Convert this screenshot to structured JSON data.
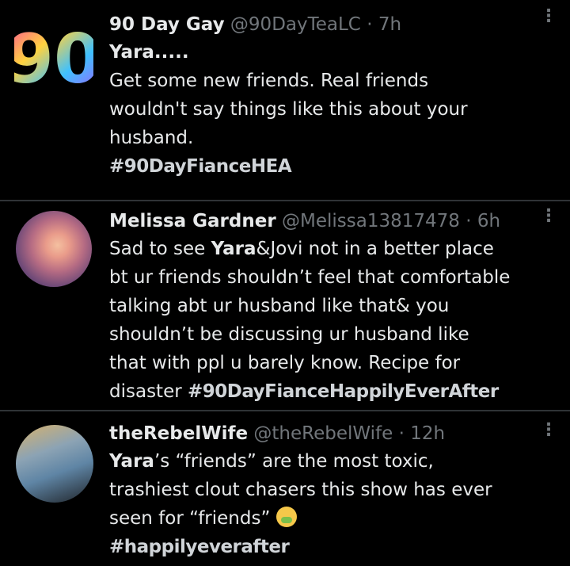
{
  "tweets": [
    {
      "name": "90 Day Gay",
      "handle": "@90DayTeaLC",
      "dot": "·",
      "time": "7h",
      "lines": [
        "Yara.....",
        "Get some new friends. Real friends",
        "wouldn't say things like this about your",
        "husband."
      ],
      "hashtag": "#90DayFianceHEA",
      "avatar_text": "90"
    },
    {
      "name": "Melissa Gardner",
      "handle": "@Melissa13817478",
      "dot": "·",
      "time": "6h",
      "lead_plain": "Sad to see ",
      "lead_bold": "Yara",
      "lead_rest": "&Jovi not in a better place",
      "lines": [
        "bt ur friends shouldn’t feel that comfortable",
        "talking abt ur husband like that& you",
        "shouldn’t be discussing ur husband  like",
        "that with ppl u barely know. Recipe for"
      ],
      "last_plain": "disaster ",
      "hashtag": "#90DayFianceHappilyEverAfter"
    },
    {
      "name": "theRebelWife",
      "handle": "@theRebelWife",
      "dot": "·",
      "time": "12h",
      "lead_bold": "Yara",
      "lead_rest": "’s “friends” are the most toxic,",
      "lines": [
        "trashiest clout chasers this show has ever"
      ],
      "last_plain": "seen for “friends” ",
      "emoji": "nauseated-face",
      "hashtag": "#happilyeverafter"
    }
  ],
  "more_glyph": "⋮"
}
